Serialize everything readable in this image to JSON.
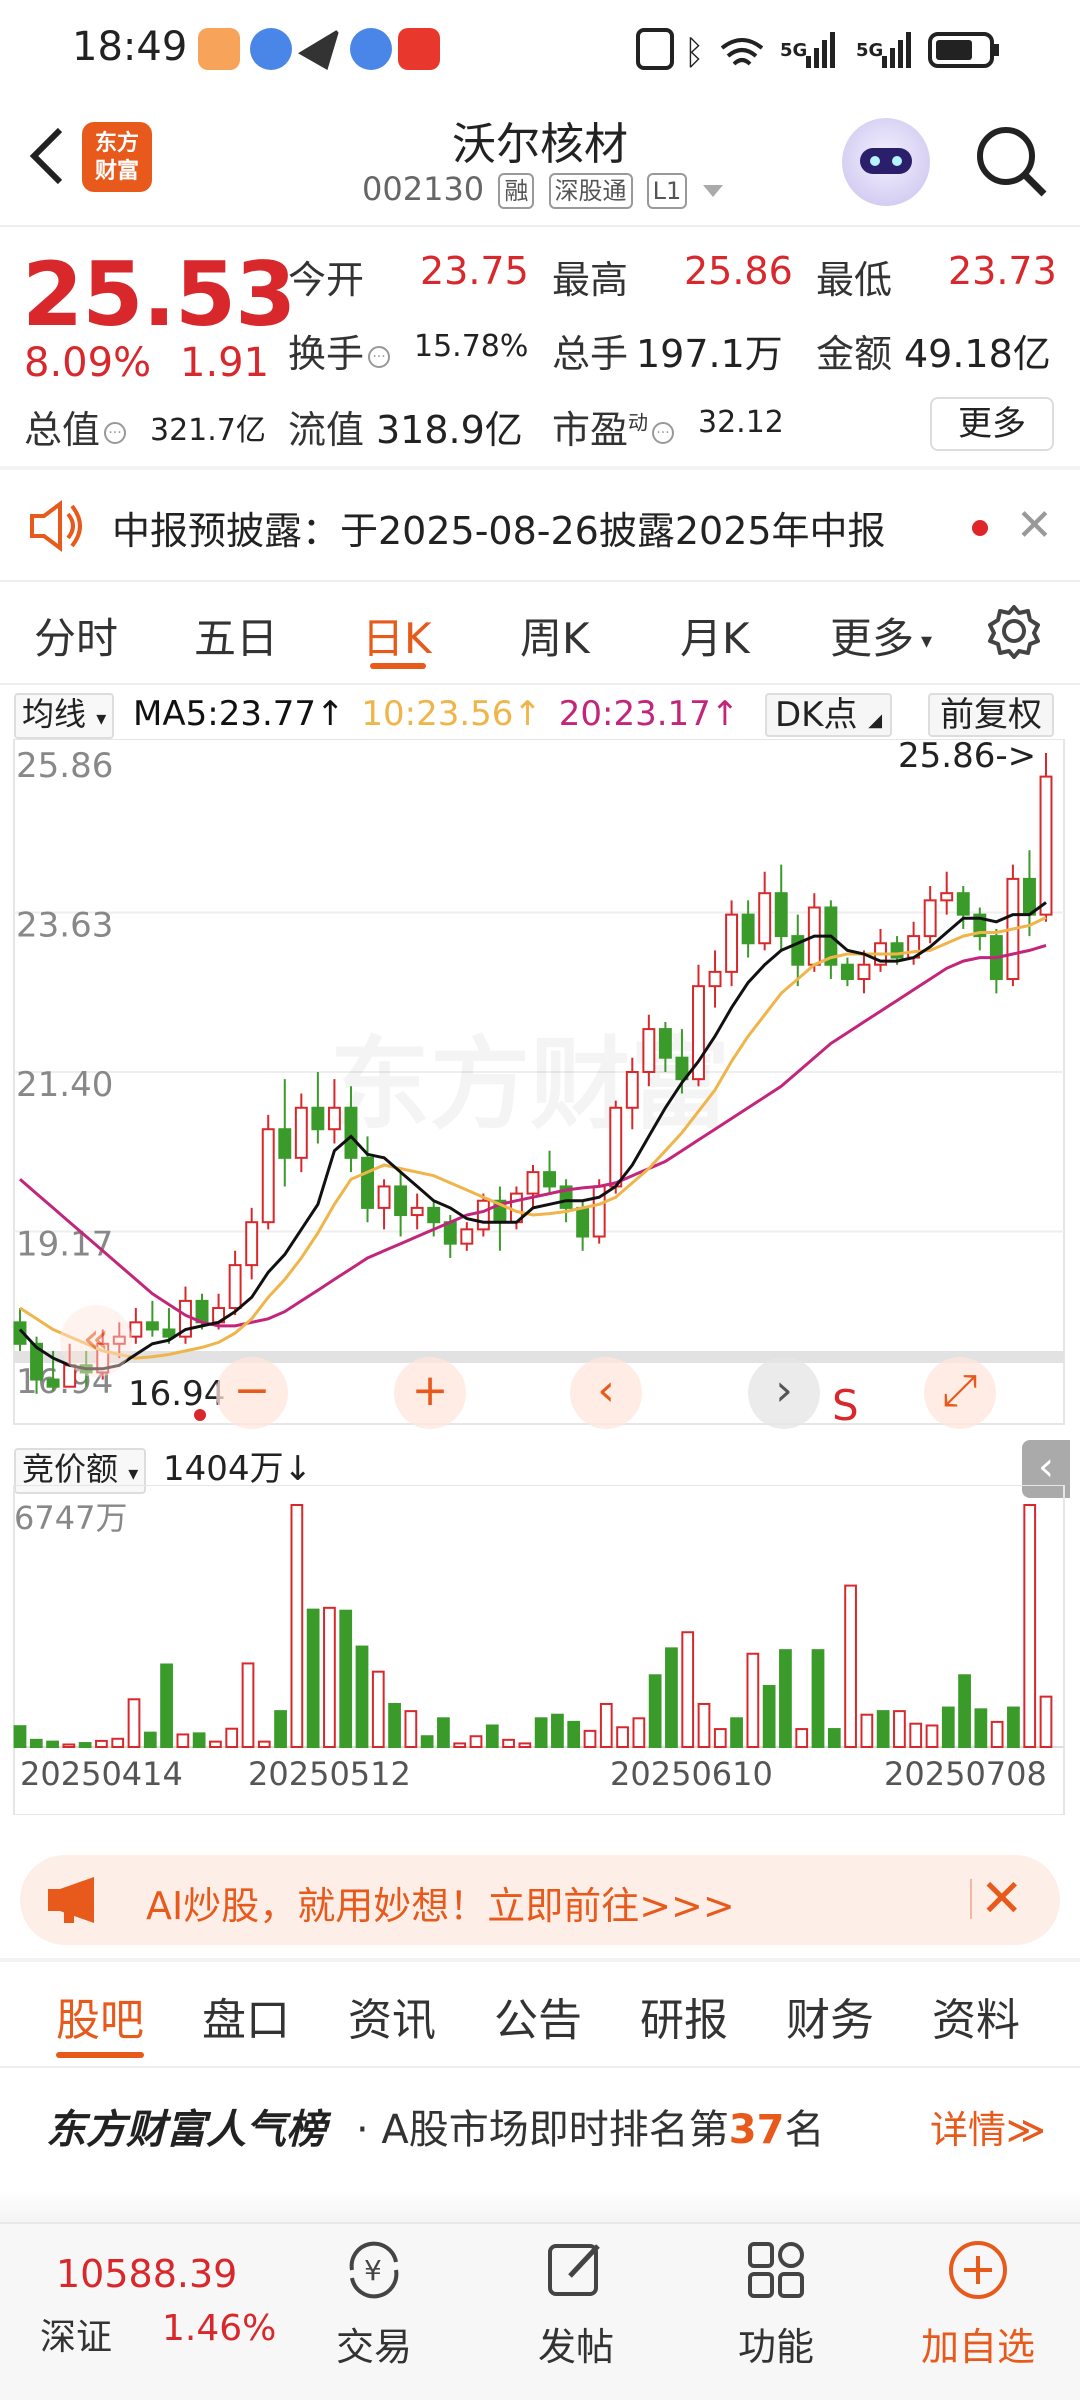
{
  "status_bar": {
    "time": "18:49",
    "icons": [
      "notification-app-icon",
      "browser-icon",
      "paper-plane-icon",
      "browser-icon",
      "app-icon"
    ],
    "right": [
      "nfc-icon",
      "bluetooth-icon",
      "wifi-icon",
      "5G",
      "5G",
      "battery-icon"
    ]
  },
  "nav": {
    "back_label": "‹",
    "logo_line1": "东方",
    "logo_line2": "财富",
    "stock_name": "沃尔核材",
    "stock_code": "002130",
    "tag_rong": "融",
    "tag_sgt": "深股通",
    "tag_level": "L1"
  },
  "quote": {
    "price": "25.53",
    "change_pct": "8.09%",
    "change": "1.91",
    "open_label": "今开",
    "open": "23.75",
    "high_label": "最高",
    "high": "25.86",
    "low_label": "最低",
    "low": "23.73",
    "turnover_label": "换手",
    "turnover": "15.78%",
    "volume_label": "总手",
    "volume": "197.1万",
    "amount_label": "金额",
    "amount": "49.18亿",
    "mktcap_label": "总值",
    "mktcap": "321.7亿",
    "float_label": "流值",
    "float_cap": "318.9亿",
    "pe_label": "市盈",
    "pe_sup": "动",
    "pe": "32.12",
    "more_label": "更多"
  },
  "notice": {
    "text": "中报预披露：于2025-08-26披露2025年中报"
  },
  "tabs": {
    "items": [
      "分时",
      "五日",
      "日K",
      "周K",
      "月K",
      "更多"
    ],
    "active": "日K"
  },
  "chart_toolbar": {
    "indicator_select": "均线",
    "ma5": "MA5:23.77↑",
    "ma10": "10:23.56↑",
    "ma20": "20:23.17↑",
    "dk_label": "DK点",
    "adjust_label": "前复权",
    "volume_select": "竞价额",
    "volume_value": "1404万↓"
  },
  "colors": {
    "up": "#d9282c",
    "down": "#3a9a2a",
    "ma5": "#111111",
    "ma10": "#f0b54a",
    "ma20": "#c2257a",
    "accent": "#e85a1c"
  },
  "chart_data": {
    "type": "candlestick",
    "y_ticks": [
      "25.86",
      "23.63",
      "21.40",
      "19.17",
      "16.94"
    ],
    "ylim": [
      16.94,
      25.86
    ],
    "x_ticks": [
      "20250414",
      "20250512",
      "20250610",
      "20250708"
    ],
    "high_marker": "25.86->",
    "low_marker": "16.94",
    "watermark": "东方财富",
    "volume_max_label": "6747万",
    "candles": [
      [
        17.9,
        18.1,
        17.5,
        17.6
      ],
      [
        17.6,
        17.7,
        16.9,
        17.1
      ],
      [
        17.1,
        17.5,
        16.94,
        17.0
      ],
      [
        17.0,
        17.6,
        17.0,
        17.3
      ],
      [
        17.3,
        17.5,
        17.0,
        17.2
      ],
      [
        17.2,
        17.8,
        17.1,
        17.6
      ],
      [
        17.6,
        17.9,
        17.4,
        17.7
      ],
      [
        17.7,
        18.1,
        17.6,
        17.9
      ],
      [
        17.9,
        18.2,
        17.7,
        17.8
      ],
      [
        17.8,
        18.1,
        17.6,
        17.7
      ],
      [
        17.7,
        18.4,
        17.6,
        18.2
      ],
      [
        18.2,
        18.3,
        17.8,
        17.9
      ],
      [
        17.9,
        18.3,
        17.8,
        18.1
      ],
      [
        18.1,
        18.9,
        18.0,
        18.7
      ],
      [
        18.7,
        19.5,
        18.5,
        19.3
      ],
      [
        19.3,
        20.8,
        19.2,
        20.6
      ],
      [
        20.6,
        21.3,
        19.8,
        20.2
      ],
      [
        20.2,
        21.1,
        20.0,
        20.9
      ],
      [
        20.9,
        21.4,
        20.4,
        20.6
      ],
      [
        20.6,
        21.3,
        20.4,
        20.9
      ],
      [
        20.9,
        21.2,
        20.0,
        20.2
      ],
      [
        20.2,
        20.5,
        19.3,
        19.5
      ],
      [
        19.5,
        19.9,
        19.2,
        19.8
      ],
      [
        19.8,
        20.0,
        19.1,
        19.4
      ],
      [
        19.4,
        19.7,
        19.2,
        19.5
      ],
      [
        19.5,
        19.6,
        19.1,
        19.3
      ],
      [
        19.3,
        19.4,
        18.8,
        19.0
      ],
      [
        19.0,
        19.3,
        18.9,
        19.2
      ],
      [
        19.2,
        19.7,
        19.1,
        19.6
      ],
      [
        19.6,
        19.8,
        18.9,
        19.3
      ],
      [
        19.3,
        19.8,
        19.2,
        19.7
      ],
      [
        19.7,
        20.1,
        19.5,
        20.0
      ],
      [
        20.0,
        20.3,
        19.7,
        19.8
      ],
      [
        19.8,
        19.9,
        19.3,
        19.5
      ],
      [
        19.5,
        19.6,
        18.9,
        19.1
      ],
      [
        19.1,
        19.9,
        19.0,
        19.8
      ],
      [
        19.8,
        21.0,
        19.7,
        20.9
      ],
      [
        20.9,
        21.6,
        20.6,
        21.4
      ],
      [
        21.4,
        22.2,
        21.2,
        22.0
      ],
      [
        22.0,
        22.1,
        21.4,
        21.6
      ],
      [
        21.6,
        22.0,
        21.1,
        21.3
      ],
      [
        21.3,
        22.9,
        21.2,
        22.6
      ],
      [
        22.6,
        23.1,
        22.3,
        22.8
      ],
      [
        22.8,
        23.8,
        22.6,
        23.6
      ],
      [
        23.6,
        23.8,
        23.0,
        23.2
      ],
      [
        23.2,
        24.2,
        23.1,
        23.9
      ],
      [
        23.9,
        24.3,
        23.1,
        23.3
      ],
      [
        23.3,
        23.6,
        22.6,
        22.9
      ],
      [
        22.9,
        23.9,
        22.8,
        23.7
      ],
      [
        23.7,
        23.8,
        22.7,
        22.9
      ],
      [
        22.9,
        23.0,
        22.6,
        22.7
      ],
      [
        22.7,
        23.1,
        22.5,
        22.9
      ],
      [
        22.9,
        23.4,
        22.8,
        23.2
      ],
      [
        23.2,
        23.3,
        22.9,
        23.0
      ],
      [
        23.0,
        23.5,
        22.9,
        23.3
      ],
      [
        23.3,
        24.0,
        23.2,
        23.8
      ],
      [
        23.8,
        24.2,
        23.6,
        23.9
      ],
      [
        23.9,
        24.0,
        23.4,
        23.6
      ],
      [
        23.6,
        23.7,
        23.1,
        23.3
      ],
      [
        23.3,
        23.4,
        22.5,
        22.7
      ],
      [
        22.7,
        24.3,
        22.6,
        24.1
      ],
      [
        24.1,
        24.5,
        23.3,
        23.6
      ],
      [
        23.6,
        25.86,
        23.5,
        25.53
      ]
    ],
    "ma5": [
      17.8,
      17.55,
      17.4,
      17.3,
      17.25,
      17.25,
      17.3,
      17.45,
      17.6,
      17.65,
      17.8,
      17.85,
      17.9,
      18.05,
      18.25,
      18.6,
      18.85,
      19.2,
      19.55,
      20.3,
      20.5,
      20.25,
      20.2,
      20.0,
      19.8,
      19.6,
      19.5,
      19.35,
      19.3,
      19.3,
      19.3,
      19.5,
      19.55,
      19.6,
      19.6,
      19.65,
      19.8,
      20.1,
      20.5,
      20.9,
      21.25,
      21.55,
      21.9,
      22.3,
      22.65,
      22.9,
      23.1,
      23.2,
      23.3,
      23.3,
      23.1,
      23.05,
      22.95,
      22.95,
      23.0,
      23.15,
      23.35,
      23.55,
      23.55,
      23.5,
      23.6,
      23.6,
      23.77
    ],
    "ma10": [
      18.1,
      17.95,
      17.8,
      17.7,
      17.6,
      17.5,
      17.45,
      17.4,
      17.42,
      17.45,
      17.5,
      17.55,
      17.62,
      17.75,
      17.95,
      18.25,
      18.5,
      18.8,
      19.15,
      19.55,
      19.9,
      20.0,
      20.1,
      20.05,
      20.0,
      19.95,
      19.85,
      19.75,
      19.65,
      19.55,
      19.45,
      19.4,
      19.42,
      19.45,
      19.5,
      19.55,
      19.65,
      19.85,
      20.05,
      20.3,
      20.55,
      20.85,
      21.15,
      21.55,
      21.9,
      22.2,
      22.5,
      22.7,
      22.9,
      23.0,
      23.05,
      23.05,
      23.05,
      23.05,
      23.08,
      23.1,
      23.2,
      23.3,
      23.35,
      23.35,
      23.4,
      23.45,
      23.56
    ],
    "ma20": [
      19.9,
      19.7,
      19.5,
      19.3,
      19.1,
      18.9,
      18.7,
      18.5,
      18.3,
      18.15,
      18.0,
      17.9,
      17.85,
      17.85,
      17.9,
      17.95,
      18.05,
      18.2,
      18.35,
      18.5,
      18.65,
      18.8,
      18.9,
      19.0,
      19.1,
      19.2,
      19.3,
      19.4,
      19.45,
      19.55,
      19.6,
      19.65,
      19.7,
      19.75,
      19.78,
      19.8,
      19.85,
      19.95,
      20.05,
      20.15,
      20.3,
      20.45,
      20.6,
      20.75,
      20.9,
      21.05,
      21.2,
      21.4,
      21.6,
      21.8,
      21.95,
      22.1,
      22.25,
      22.4,
      22.55,
      22.7,
      22.85,
      22.95,
      23.0,
      23.0,
      23.05,
      23.1,
      23.17
    ],
    "volume_units": "万",
    "volumes": [
      580,
      200,
      150,
      70,
      110,
      170,
      230,
      1330,
      400,
      2300,
      350,
      380,
      150,
      510,
      2330,
      150,
      1000,
      6747,
      3830,
      3880,
      3800,
      2800,
      2100,
      1200,
      1000,
      300,
      800,
      100,
      300,
      600,
      200,
      100,
      800,
      900,
      700,
      450,
      1200,
      550,
      800,
      2000,
      2750,
      3200,
      1200,
      500,
      800,
      2600,
      1700,
      2700,
      500,
      2700,
      500,
      4500,
      900,
      1000,
      1000,
      650,
      600,
      1100,
      2000,
      1050,
      700,
      1100,
      6747,
      1404
    ]
  },
  "chart_controls": [
    "minus-icon",
    "plus-icon",
    "chevron-left-icon",
    "chevron-right-icon",
    "expand-icon"
  ],
  "s_label": "S",
  "ai_banner": {
    "text": "AI炒股，就用妙想！立即前往>>>"
  },
  "section_tabs": {
    "items": [
      "股吧",
      "盘口",
      "资讯",
      "公告",
      "研报",
      "财务",
      "资料"
    ],
    "active": "股吧"
  },
  "rank": {
    "title": "东方财富人气榜",
    "text_prefix": "· A股市场即时排名第",
    "rank": "37",
    "text_suffix": "名",
    "detail": "详情≫"
  },
  "bottom_bar": {
    "index_value": "10588.39",
    "index_name": "深证",
    "index_pct": "1.46%",
    "trade": "交易",
    "post": "发帖",
    "func": "功能",
    "add": "加自选"
  }
}
